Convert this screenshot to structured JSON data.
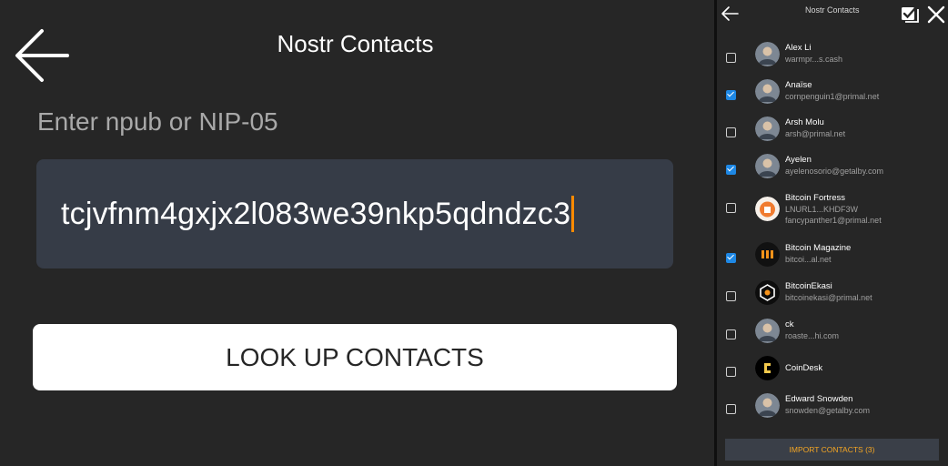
{
  "main": {
    "title": "Nostr Contacts",
    "prompt": "Enter npub or NIP-05",
    "input_value": "tcjvfnm4gxjx2l083we39nkp5qdndzc3",
    "lookup_label": "LOOK UP CONTACTS",
    "caret_color": "#ff8a00"
  },
  "panel": {
    "title": "Nostr Contacts",
    "import_label": "IMPORT CONTACTS (3)",
    "contacts": [
      {
        "name": "Alex Li",
        "lines": [
          "warmpr...s.cash"
        ],
        "checked": false,
        "avatar": "photo-avatar"
      },
      {
        "name": "Anaïse",
        "lines": [
          "cornpenguin1@primal.net"
        ],
        "checked": true,
        "avatar": "photo-avatar"
      },
      {
        "name": "Arsh Molu",
        "lines": [
          "arsh@primal.net"
        ],
        "checked": false,
        "avatar": "photo-avatar"
      },
      {
        "name": "Ayelen",
        "lines": [
          "ayelenosorio@getalby.com"
        ],
        "checked": true,
        "avatar": "photo-avatar"
      },
      {
        "name": "Bitcoin Fortress",
        "lines": [
          "LNURL1...KHDF3W",
          "fancypanther1@primal.net"
        ],
        "checked": false,
        "avatar": "fortress-logo"
      },
      {
        "name": "Bitcoin Magazine",
        "lines": [
          "bitcoi...al.net"
        ],
        "checked": true,
        "avatar": "magazine-logo"
      },
      {
        "name": "BitcoinEkasi",
        "lines": [
          "bitcoinekasi@primal.net"
        ],
        "checked": false,
        "avatar": "ekasi-logo"
      },
      {
        "name": "ck",
        "lines": [
          "roaste...hi.com"
        ],
        "checked": false,
        "avatar": "photo-avatar"
      },
      {
        "name": "CoinDesk",
        "lines": [],
        "checked": false,
        "avatar": "coindesk-logo"
      },
      {
        "name": "Edward Snowden",
        "lines": [
          "snowden@getalby.com"
        ],
        "checked": false,
        "avatar": "photo-avatar"
      }
    ]
  }
}
